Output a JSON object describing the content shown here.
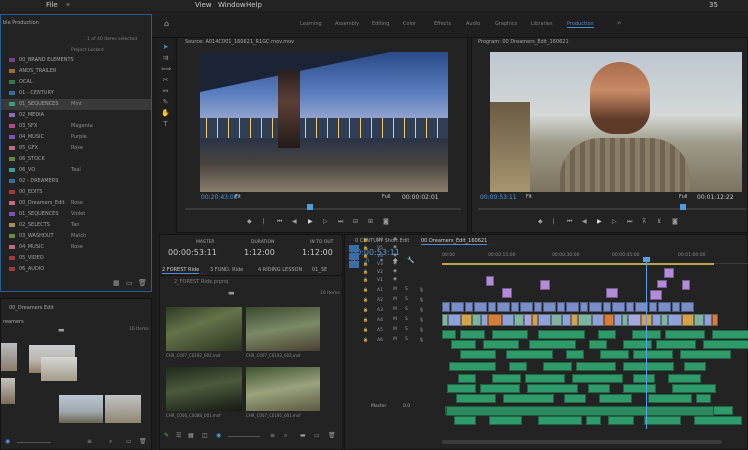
{
  "menu": {
    "file": "File",
    "view": "View",
    "window": "Window",
    "help": "Help",
    "right_number": "35"
  },
  "workspaces": [
    {
      "label": "Learning",
      "active": false
    },
    {
      "label": "Assembly",
      "active": false
    },
    {
      "label": "Editing",
      "active": false
    },
    {
      "label": "Color",
      "active": false
    },
    {
      "label": "Effects",
      "active": false
    },
    {
      "label": "Audio",
      "active": false
    },
    {
      "label": "Graphics",
      "active": false
    },
    {
      "label": "Libraries",
      "active": false
    },
    {
      "label": "Production",
      "active": true
    }
  ],
  "project": {
    "title": "ble Production",
    "count": "1 of 40 items selected",
    "locked": "Project Locked",
    "items": [
      {
        "name": "00_BRAND ELEMENTS",
        "label": "",
        "color": "#7a3e8f"
      },
      {
        "name": "ANDS_TRAILER",
        "label": "",
        "color": "#a06c2a"
      },
      {
        "name": "OCAL",
        "label": "",
        "color": "#2f7a52"
      },
      {
        "name": "01 - CENTURY",
        "label": "",
        "color": "#3b6ea8"
      },
      {
        "name": "01_SEQUENCES",
        "label": "Mint",
        "color": "#3f9e7a"
      },
      {
        "name": "02_MEDIA",
        "label": "",
        "color": "#8a6db5"
      },
      {
        "name": "03_SFX",
        "label": "Magenta",
        "color": "#b5488e"
      },
      {
        "name": "04_MUSIC",
        "label": "Purple",
        "color": "#7c52b8"
      },
      {
        "name": "05_GFX",
        "label": "Rose",
        "color": "#c26a7d"
      },
      {
        "name": "06_STOCK",
        "label": "",
        "color": "#5f8c3e"
      },
      {
        "name": "06_VO",
        "label": "Teal",
        "color": "#3c9ba3"
      },
      {
        "name": "02 - DREAMERS",
        "label": "",
        "color": "#3b6ea8"
      },
      {
        "name": "00_EDITS",
        "label": "",
        "color": "#a03c3c"
      },
      {
        "name": "00_Dreamers_Edit",
        "label": "Rose",
        "color": "#c26a7d"
      },
      {
        "name": "01_SEQUENCES",
        "label": "Violet",
        "color": "#7c52b8"
      },
      {
        "name": "02_SELECTS",
        "label": "Tan",
        "color": "#a98a5c"
      },
      {
        "name": "03_WASHOUT",
        "label": "Match",
        "color": "#6a8f3c"
      },
      {
        "name": "04_MUSIC",
        "label": "Rose",
        "color": "#c26a7d"
      },
      {
        "name": "05_VIDEO",
        "label": "",
        "color": "#a03c3c"
      },
      {
        "name": "06_AUDIO",
        "label": "",
        "color": "#a03c3c"
      }
    ]
  },
  "lower_left": {
    "title": "00_Dreamers Edit",
    "subtitle": "reamers",
    "count": "16 Items"
  },
  "source": {
    "title": "Source: A014C001_160621_R1GC.mov.mov",
    "tc_in": "00:20:43:06",
    "fit": "Fit",
    "full": "Full",
    "tc_dur": "00:00:02:01"
  },
  "program": {
    "title": "Program: 00 Dreamers_Edit_160621",
    "tc_in": "00:00:53:11",
    "fit": "Fit",
    "full": "Full",
    "tc_dur": "00:01:12:22"
  },
  "bin": {
    "master_label": "MASTER",
    "master_tc": "00:00:53:11",
    "duration_label": "DURATION",
    "duration_tc": "1:12:00",
    "intout_label": "IN TO OUT",
    "intout_tc": "1:12:00",
    "tabs": [
      "2 FOREST Ride",
      "3 FUND. Ride",
      "4 RIDING LESSON",
      "01_SE"
    ],
    "path": "2_FOREST Ride.prproj",
    "count": "16 Items",
    "clips": [
      {
        "name": "CHR_C007_C0192_001.mxf"
      },
      {
        "name": "CHR_C007_C0193_003.mxf"
      },
      {
        "name": "CHR_C006_C0088_001.mxf"
      },
      {
        "name": "CHR_C007_C0195_001.mxf"
      }
    ]
  },
  "timeline": {
    "tabs": [
      "0 CENTURY Short Edit",
      "00 Dreamers_Edit_160621"
    ],
    "tc": "00:00:53:11",
    "ruler": [
      "00:00",
      "00:00:15:00",
      "00:00:30:00",
      "00:00:45:00",
      "00:01:00:00"
    ],
    "tracks_v": [
      "V6",
      "V5",
      "V4",
      "V3",
      "V2",
      "V1"
    ],
    "tracks_a": [
      "A1",
      "A2",
      "A3",
      "A4",
      "A5",
      "A6"
    ],
    "master_label": "Master",
    "master_val": "0.0"
  },
  "colors": {
    "accent": "#4f8dd1",
    "playhead": "#5aa0e6",
    "video_clip": "#7a8fc7",
    "audio_clip": "#2f9a6a",
    "label_purple": "#b48bd9"
  }
}
